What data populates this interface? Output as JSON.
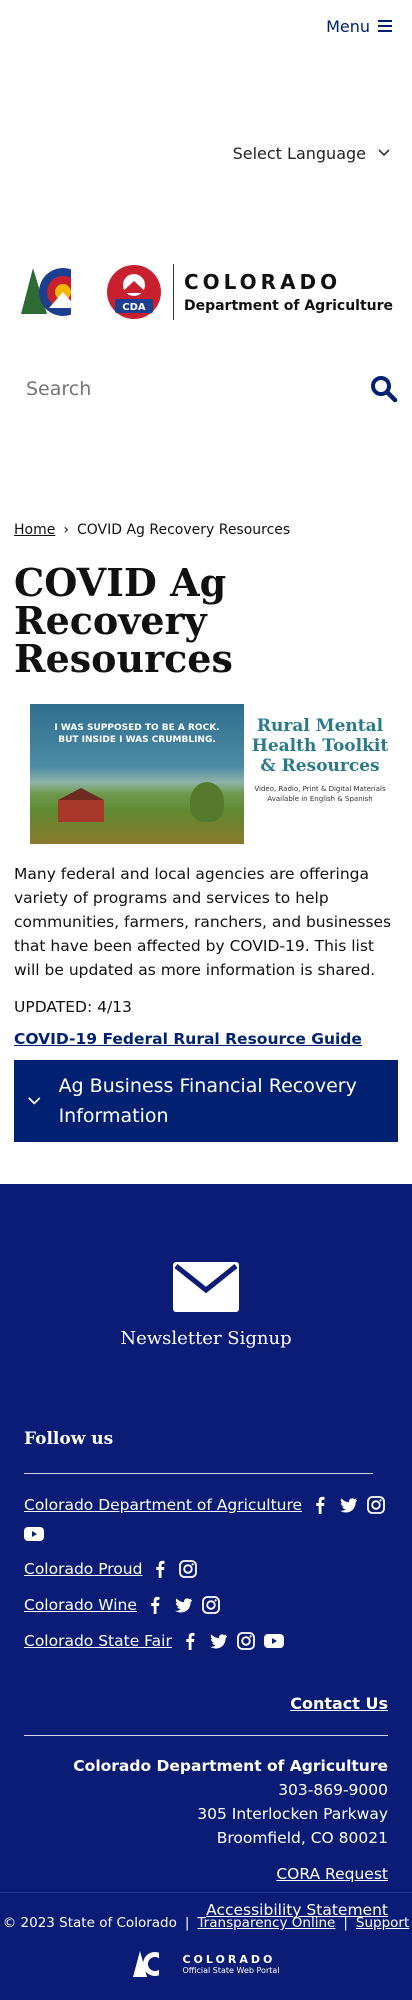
{
  "header": {
    "menu_label": "Menu",
    "language_label": "Select Language",
    "logo": {
      "word1": "COLORADO",
      "word2": "Department of Agriculture",
      "badge": "CDA"
    },
    "search_placeholder": "Search"
  },
  "breadcrumb": {
    "home": "Home",
    "separator": "›",
    "current": "COVID Ag Recovery Resources"
  },
  "page": {
    "title": "COVID Ag Recovery Resources",
    "banner": {
      "quote_line1": "I WAS SUPPOSED TO BE A ROCK.",
      "quote_line2": "BUT INSIDE I WAS CRUMBLING.",
      "title_line1": "Rural Mental",
      "title_line2": "Health Toolkit",
      "title_line3": "& Resources",
      "sub_line1": "Video, Radio, Print & Digital Materials",
      "sub_line2": "Available in English & Spanish"
    },
    "intro": "Many federal and local agencies are offeringa variety of programs and services to help communities, farmers, ranchers, and businesses that have been affected by COVID-19. This list will be updated as more information is shared.",
    "updated": "UPDATED: 4/13",
    "guide_link": "COVID-19 Federal Rural Resource Guide",
    "accordion_label": "Ag Business Financial Recovery Information"
  },
  "footer": {
    "newsletter": "Newsletter Signup",
    "follow_heading": "Follow us",
    "social": [
      {
        "name": "Colorado Department of Agriculture"
      },
      {
        "name": "Colorado Proud"
      },
      {
        "name": "Colorado Wine"
      },
      {
        "name": "Colorado State Fair"
      }
    ],
    "contact_link": "Contact Us",
    "org": "Colorado Department of Agriculture",
    "phone": "303-869-9000",
    "street": "305 Interlocken Parkway",
    "city": "Broomfield, CO 80021",
    "cora": "CORA Request",
    "accessibility": "Accessibility Statement",
    "copyright": "© 2023 State of Colorado",
    "sep": "|",
    "transparency": "Transparency Online",
    "support": "Support",
    "state_logo1": "COLORADO",
    "state_logo2": "Official State Web Portal"
  },
  "colors": {
    "brand_navy": "#0a1c76",
    "accent_blue": "#002171"
  }
}
